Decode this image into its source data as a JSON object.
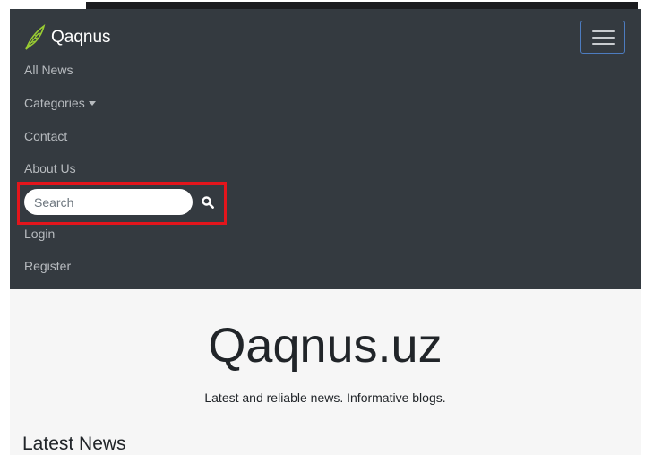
{
  "brand": {
    "name": "Qaqnus",
    "icon": "feather-icon"
  },
  "nav": {
    "items": [
      {
        "label": "All News"
      },
      {
        "label": "Categories"
      },
      {
        "label": "Contact"
      },
      {
        "label": "About Us"
      },
      {
        "label": "Login"
      },
      {
        "label": "Register"
      }
    ],
    "toggler_icon": "hamburger-menu-icon"
  },
  "search": {
    "placeholder": "Search",
    "value": "",
    "icon": "search-icon"
  },
  "hero": {
    "title": "Qaqnus.uz",
    "subtitle": "Latest and reliable news. Informative blogs."
  },
  "section": {
    "title": "Latest News"
  },
  "colors": {
    "navbar_bg": "#343a40",
    "nav_link": "#b7bbbf",
    "toggler_border": "#4d7cc0",
    "highlight": "#e3151c",
    "hero_bg": "#f6f6f6",
    "text_dark": "#212529"
  }
}
